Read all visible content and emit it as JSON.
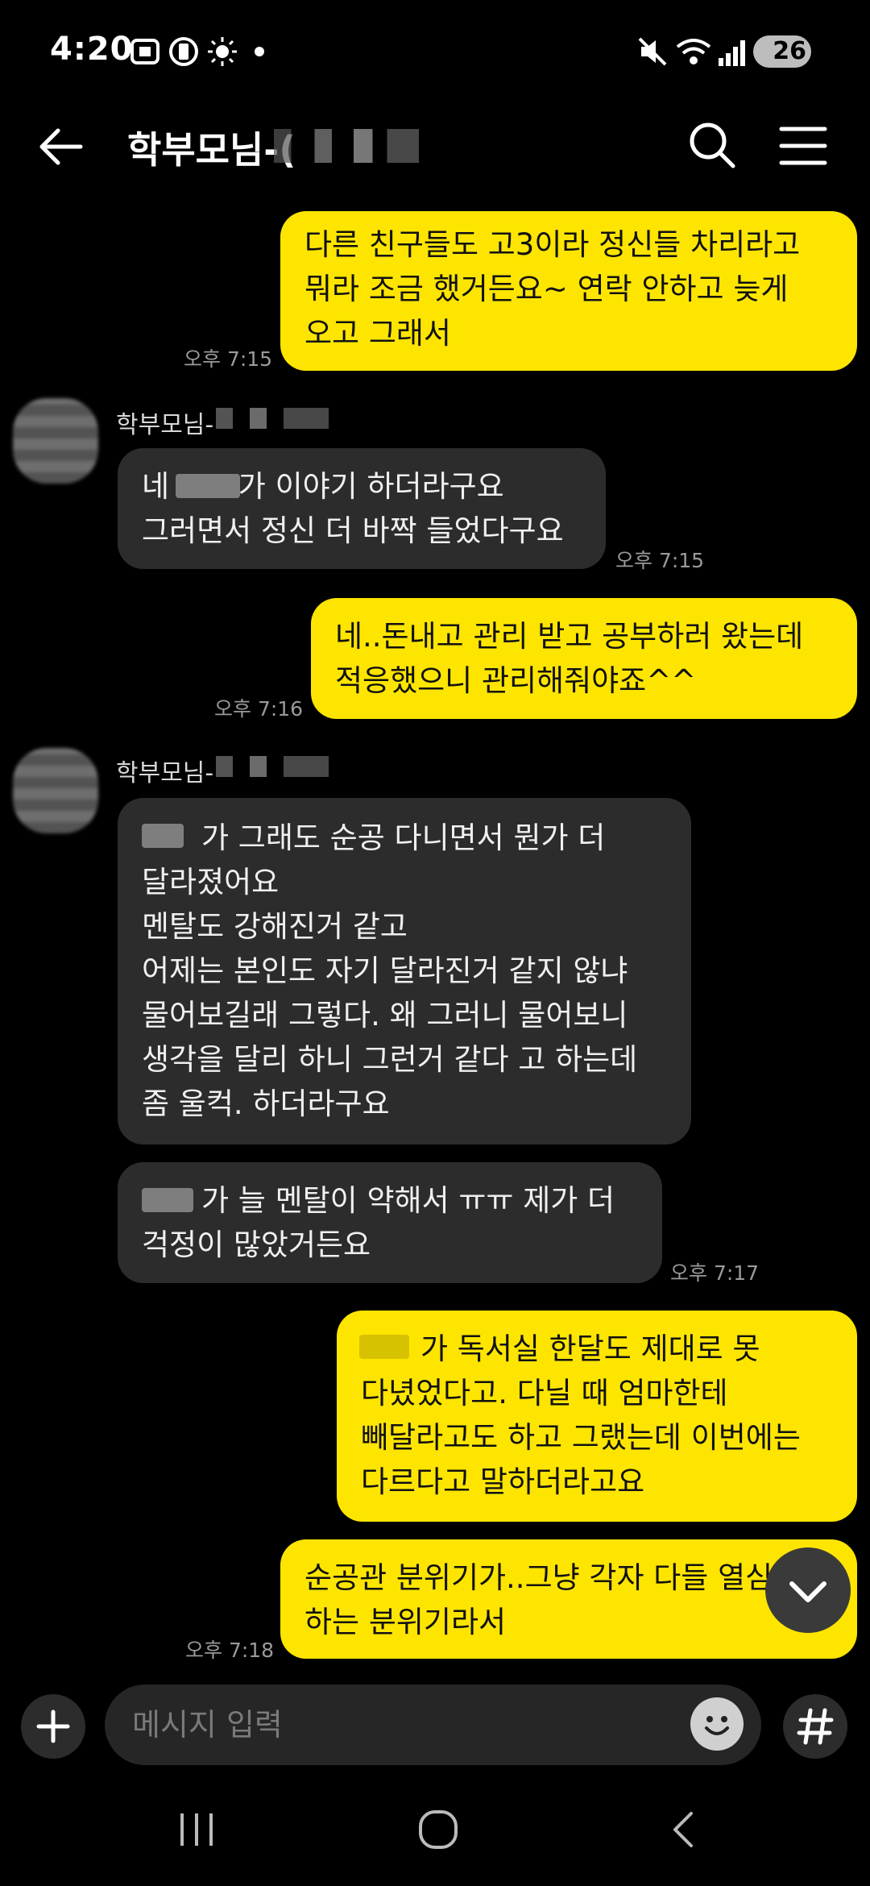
{
  "status_bar": {
    "time": "4:20",
    "battery": "26"
  },
  "header": {
    "title": "학부모님-("
  },
  "messages": [
    {
      "sender": "me",
      "text": "다른 친구들도 고3이라 정신들 차리라고\n뭐라 조금 했거든요~ 연락 안하고 늦게\n오고 그래서",
      "time": "오후 7:15"
    },
    {
      "sender_name": "학부모님-",
      "text": "네 　　가 이야기 하더라구요\n그러면서 정신 더 바짝 들었다구요",
      "time": "오후 7:15"
    },
    {
      "sender": "me",
      "text": "네..돈내고 관리 받고 공부하러 왔는데\n적응했으니 관리해줘야죠^^",
      "time": "오후 7:16"
    },
    {
      "sender_name": "학부모님-",
      "text": "　　가 그래도 순공 다니면서 뭔가 더\n달라졌어요\n멘탈도 강해진거 같고\n어제는 본인도 자기 달라진거 같지 않냐\n물어보길래 그렇다. 왜 그러니 물어보니\n생각을 달리 하니 그런거 같다 고 하는데\n좀 울컥. 하더라구요"
    },
    {
      "text": "　　가 늘 멘탈이 약해서 ㅠㅠ 제가 더\n걱정이 많았거든요",
      "time": "오후 7:17"
    },
    {
      "sender": "me",
      "text": "　　가 독서실 한달도 제대로 못\n다녔었다고. 다닐 때 엄마한테\n빼달라고도 하고 그랬는데 이번에는\n다르다고 말하더라고요"
    },
    {
      "sender": "me",
      "text": "순공관 분위기가..그냥 각자 다들 열심히\n하는 분위기라서",
      "time": "오후 7:18"
    }
  ],
  "input": {
    "placeholder": "메시지 입력"
  },
  "colors": {
    "my_bubble": "#fee500",
    "other_bubble": "#2c2c2c",
    "background": "#000000"
  }
}
